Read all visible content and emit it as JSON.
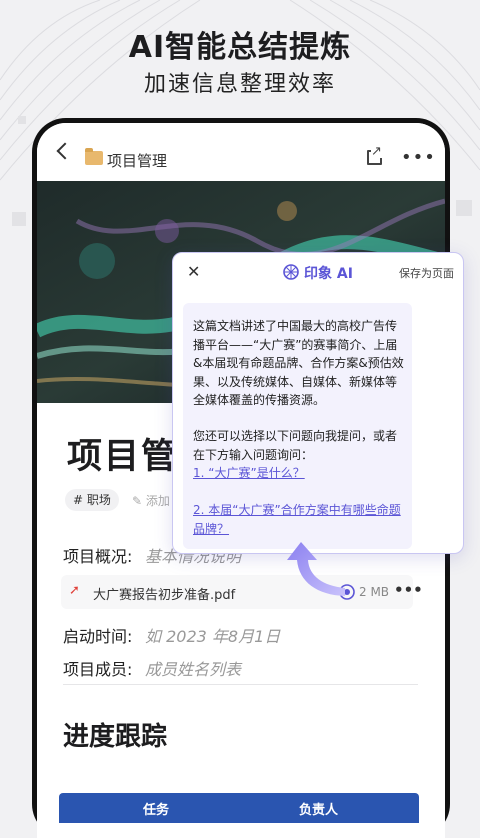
{
  "hero": {
    "title": "AI智能总结提炼",
    "subtitle": "加速信息整理效率"
  },
  "topbar": {
    "title": "项目管理",
    "more": "•••"
  },
  "document": {
    "title": "项目管",
    "tag": "# 职场",
    "add_tag": "添加",
    "overview_label": "项目概况:",
    "overview_value": "基本情况说明",
    "attachment": {
      "name": "大广赛报告初步准备.pdf",
      "size": "2 MB",
      "more": "•••"
    },
    "start_label": "启动时间:",
    "start_value": "如 2023 年8月1日",
    "members_label": "项目成员:",
    "members_value": "成员姓名列表",
    "section_title": "进度跟踪",
    "table_headers": [
      "任务",
      "负责人"
    ]
  },
  "ai_panel": {
    "close": "✕",
    "brand": "印象 AI",
    "save_label": "保存为页面",
    "summary": "这篇文档讲述了中国最大的高校广告传播平台——“大广赛”的赛事简介、上届&本届现有命题品牌、合作方案&预估效果、以及传统媒体、自媒体、新媒体等全媒体覆盖的传播资源。",
    "prompt": "您还可以选择以下问题向我提问，或者在下方输入问题询问：",
    "questions": [
      "1. “大广赛”是什么？",
      "2. 本届“大广赛”合作方案中有哪些命题品牌？"
    ]
  },
  "colors": {
    "accent": "#5b55d6",
    "table_header": "#2a55b0",
    "pdf": "#e0413a"
  }
}
